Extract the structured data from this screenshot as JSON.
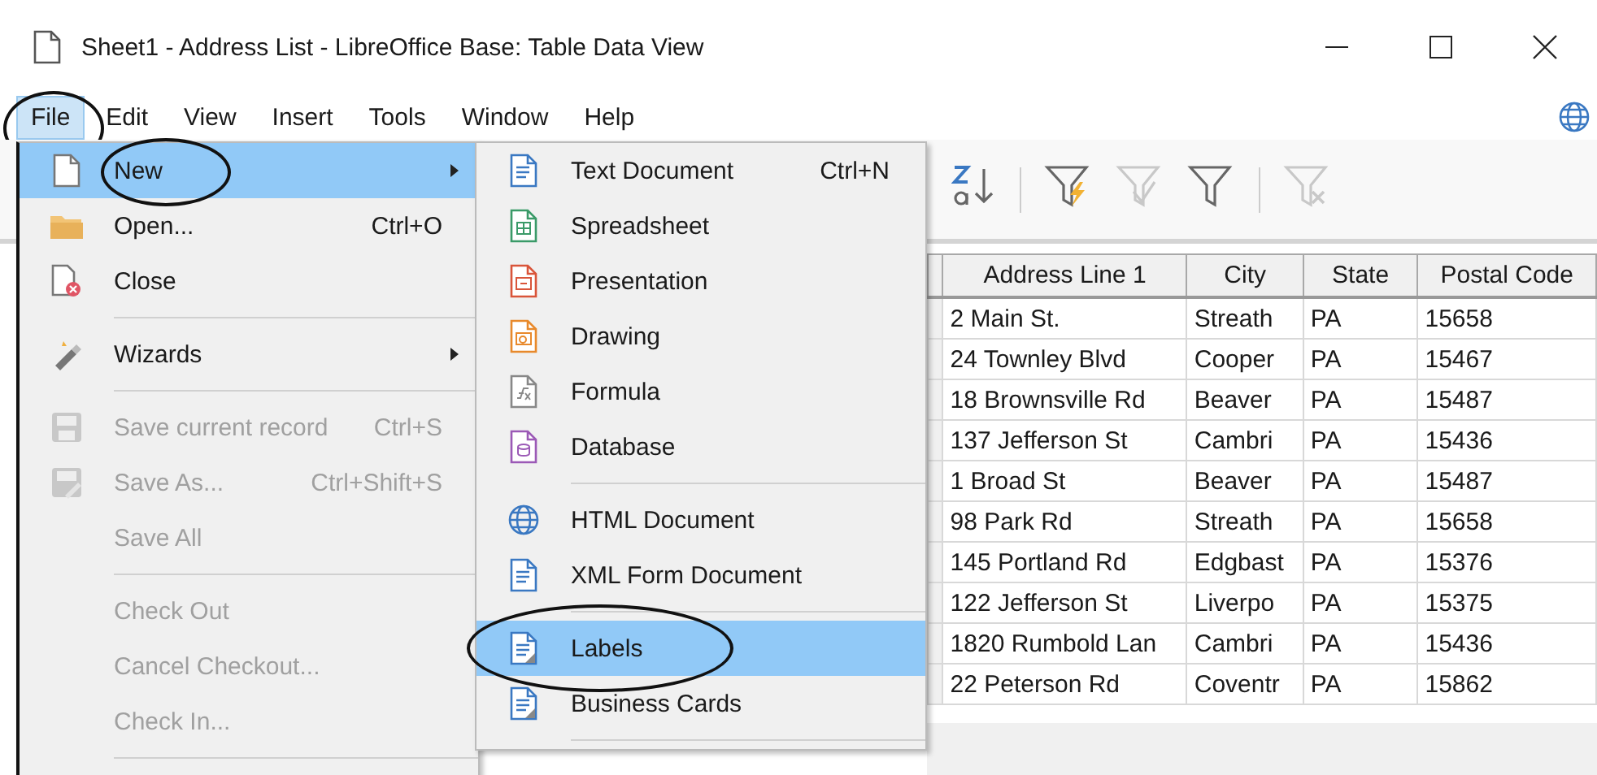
{
  "window": {
    "title": "Sheet1 - Address List - LibreOffice Base: Table Data View"
  },
  "menu_bar": [
    {
      "label": "File",
      "selected": true,
      "circled": true
    },
    {
      "label": "Edit",
      "selected": false,
      "circled": false
    },
    {
      "label": "View",
      "selected": false,
      "circled": false
    },
    {
      "label": "Insert",
      "selected": false,
      "circled": false
    },
    {
      "label": "Tools",
      "selected": false,
      "circled": false
    },
    {
      "label": "Window",
      "selected": false,
      "circled": false
    },
    {
      "label": "Help",
      "selected": false,
      "circled": false
    }
  ],
  "file_menu": [
    {
      "kind": "item",
      "label": "New",
      "selected": true,
      "submenu": true,
      "circled": true,
      "disabled": false
    },
    {
      "kind": "item",
      "label": "Open...",
      "shortcut": "Ctrl+O",
      "selected": false,
      "submenu": false,
      "circled": false,
      "disabled": false
    },
    {
      "kind": "item",
      "label": "Close",
      "selected": false,
      "submenu": false,
      "circled": false,
      "disabled": false
    },
    {
      "kind": "separator"
    },
    {
      "kind": "item",
      "label": "Wizards",
      "selected": false,
      "submenu": true,
      "circled": false,
      "disabled": false
    },
    {
      "kind": "separator"
    },
    {
      "kind": "item",
      "label": "Save current record",
      "shortcut": "Ctrl+S",
      "selected": false,
      "submenu": false,
      "circled": false,
      "disabled": true
    },
    {
      "kind": "item",
      "label": "Save As...",
      "shortcut": "Ctrl+Shift+S",
      "selected": false,
      "submenu": false,
      "circled": false,
      "disabled": true
    },
    {
      "kind": "item",
      "label": "Save All",
      "selected": false,
      "submenu": false,
      "circled": false,
      "disabled": true
    },
    {
      "kind": "separator"
    },
    {
      "kind": "item",
      "label": "Check Out",
      "selected": false,
      "submenu": false,
      "circled": false,
      "disabled": true
    },
    {
      "kind": "item",
      "label": "Cancel Checkout...",
      "selected": false,
      "submenu": false,
      "circled": false,
      "disabled": true
    },
    {
      "kind": "item",
      "label": "Check In...",
      "selected": false,
      "submenu": false,
      "circled": false,
      "disabled": true
    },
    {
      "kind": "separator"
    }
  ],
  "new_submenu": [
    {
      "kind": "item",
      "label": "Text Document",
      "shortcut": "Ctrl+N",
      "selected": false,
      "circled": false
    },
    {
      "kind": "item",
      "label": "Spreadsheet",
      "selected": false,
      "circled": false
    },
    {
      "kind": "item",
      "label": "Presentation",
      "selected": false,
      "circled": false
    },
    {
      "kind": "item",
      "label": "Drawing",
      "selected": false,
      "circled": false
    },
    {
      "kind": "item",
      "label": "Formula",
      "selected": false,
      "circled": false
    },
    {
      "kind": "item",
      "label": "Database",
      "selected": false,
      "circled": false
    },
    {
      "kind": "separator"
    },
    {
      "kind": "item",
      "label": "HTML Document",
      "selected": false,
      "circled": false
    },
    {
      "kind": "item",
      "label": "XML Form Document",
      "selected": false,
      "circled": false
    },
    {
      "kind": "separator"
    },
    {
      "kind": "item",
      "label": "Labels",
      "selected": true,
      "circled": true
    },
    {
      "kind": "item",
      "label": "Business Cards",
      "selected": false,
      "circled": false
    },
    {
      "kind": "separator"
    }
  ],
  "toolbar": [
    {
      "kind": "button",
      "disabled": false
    },
    {
      "kind": "separator"
    },
    {
      "kind": "button",
      "disabled": false
    },
    {
      "kind": "button",
      "disabled": true
    },
    {
      "kind": "button",
      "disabled": false
    },
    {
      "kind": "separator"
    },
    {
      "kind": "button",
      "disabled": true
    }
  ],
  "table": {
    "columns": [
      "Address Line 1",
      "City",
      "State",
      "Postal Code"
    ],
    "rows": [
      [
        "2 Main St.",
        "Streath",
        "PA",
        "15658"
      ],
      [
        "24 Townley Blvd",
        "Cooper",
        "PA",
        "15467"
      ],
      [
        "18 Brownsville Rd",
        "Beaver",
        "PA",
        "15487"
      ],
      [
        "137 Jefferson St",
        "Cambri",
        "PA",
        "15436"
      ],
      [
        "1 Broad St",
        "Beaver",
        "PA",
        "15487"
      ],
      [
        "98 Park Rd",
        "Streath",
        "PA",
        "15658"
      ],
      [
        "145 Portland Rd",
        "Edgbast",
        "PA",
        "15376"
      ],
      [
        "122 Jefferson St",
        "Liverpo",
        "PA",
        "15375"
      ],
      [
        "1820 Rumbold Lan",
        "Cambri",
        "PA",
        "15436"
      ],
      [
        "22 Peterson Rd",
        "Coventr",
        "PA",
        "15862"
      ]
    ]
  }
}
